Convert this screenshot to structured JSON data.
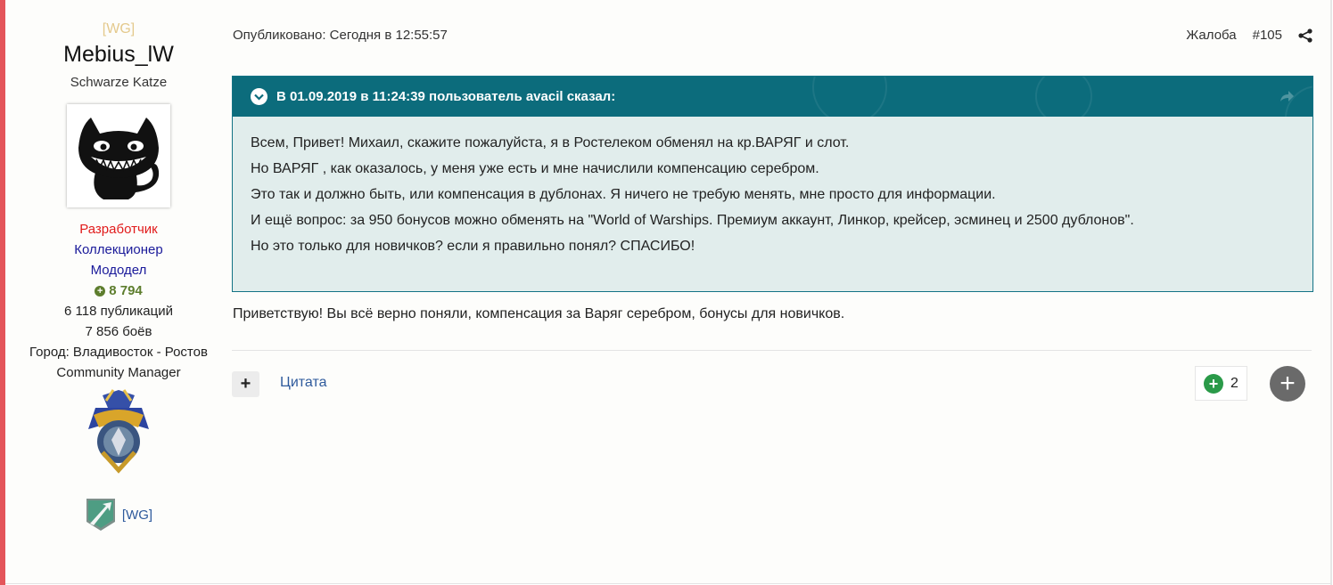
{
  "author": {
    "clan_tag": "[WG]",
    "username": "Mebius_lW",
    "title": "Schwarze Katze",
    "groups": {
      "developer": "Разработчик",
      "collector": "Коллекционер",
      "modeler": "Мододел"
    },
    "reputation": "8 794",
    "posts": "6 118 публикаций",
    "battles": "7 856 боёв",
    "city": "Город: Владивосток - Ростов",
    "role": "Community Manager",
    "clan_link": "[WG]"
  },
  "post": {
    "posted": "Опубликовано: Сегодня в 12:55:57",
    "report": "Жалоба",
    "number": "#105",
    "quote": {
      "header": "В 01.09.2019 в 11:24:39 пользователь avacil сказал:",
      "lines": [
        "Всем, Привет! Михаил, скажите пожалуйста, я в Ростелеком обменял на кр.ВАРЯГ и слот.",
        "Но ВАРЯГ , как оказалось, у меня уже есть и мне начислили компенсацию серебром.",
        "Это так и должно быть, или компенсация в дублонах. Я ничего не требую менять, мне просто для информации.",
        "И ещё вопрос: за 950 бонусов можно обменять на \"World of Warships. Премиум аккаунт, Линкор, крейсер, эсминец и 2500 дублонов\".",
        "Но это только для новичков? если я правильно понял? СПАСИБО!"
      ]
    },
    "reply": "Приветствую! Вы всё верно поняли, компенсация за Варяг серебром, бонусы для новичков."
  },
  "controls": {
    "multiquote": "+",
    "quote_label": "Цитата",
    "reputation_plus": "+",
    "reputation_count": "2",
    "react": "+"
  },
  "colors": {
    "accent": "#e4555a",
    "quote_header": "#0c6c7c",
    "quote_bg": "#e1edec",
    "developer": "#e11b1b",
    "group": "#1a1a9a",
    "reputation": "#5d7d2d",
    "link": "#2e5a9c",
    "rep_button": "#2a9a49"
  },
  "icons": [
    "chevron-down-icon",
    "share-icon",
    "jump-to-post-icon",
    "reputation-plus-icon",
    "react-icon"
  ]
}
